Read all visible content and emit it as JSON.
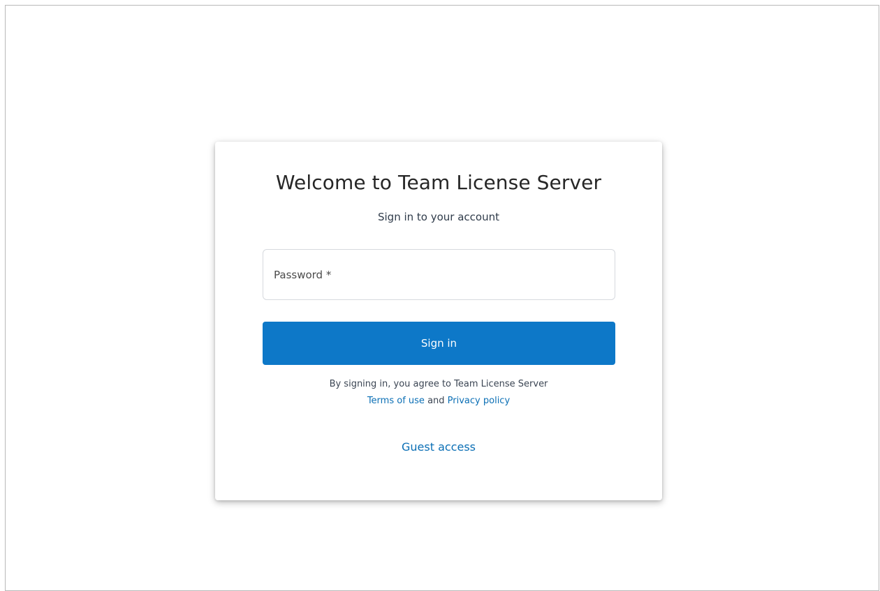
{
  "login": {
    "title": "Welcome to Team License Server",
    "subtitle": "Sign in to your account",
    "password": {
      "placeholder": "Password *",
      "value": ""
    },
    "signin_label": "Sign in",
    "agreement_text": "By signing in, you agree to Team License Server",
    "terms_label": "Terms of use",
    "and_label": "and",
    "privacy_label": "Privacy policy",
    "guest_label": "Guest access"
  },
  "colors": {
    "primary": "#0d78c8",
    "link": "#0b6fb5",
    "background": "#ffffff"
  }
}
